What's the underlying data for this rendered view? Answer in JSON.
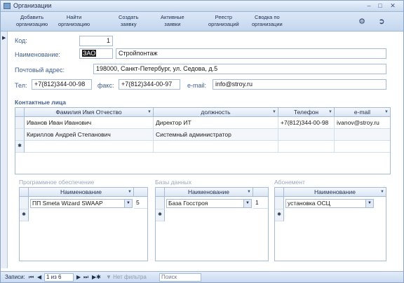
{
  "window": {
    "title": "Организации"
  },
  "toolbar": {
    "add_org": [
      "Добавить",
      "организацию"
    ],
    "find_org": [
      "Найти",
      "организацию"
    ],
    "create_req": [
      "Создать",
      "заявку"
    ],
    "active_req": [
      "Активные",
      "заявки"
    ],
    "registry": [
      "Реестр",
      "организаций"
    ],
    "summary": [
      "Сводка по",
      "организации"
    ]
  },
  "form": {
    "code_label": "Код:",
    "code_value": "1",
    "name_label": "Наименование:",
    "name_prefix": "ЗАО",
    "name_value": "Стройпонтаж",
    "address_label": "Почтовый адрес:",
    "address_value": "198000, Санкт-Петербург, ул. Седова, д.5",
    "phone_label": "Тел:",
    "phone_value": "+7(812)344-00-98",
    "fax_label": "факс:",
    "fax_value": "+7(812)344-00-97",
    "email_label": "e-mail:",
    "email_value": "info@stroy.ru"
  },
  "contacts": {
    "header": "Контактные лица",
    "columns": [
      "Фамилия Имя Отчество",
      "должность",
      "Телефон",
      "e-mail"
    ],
    "rows": [
      [
        "Иванов Иван Иванович",
        "Директор ИТ",
        "+7(812)344-00-98",
        "ivanov@stroy.ru"
      ],
      [
        "Кириллов Андрей Степанович",
        "Системный администратор",
        "",
        ""
      ]
    ]
  },
  "software": {
    "header": "Программное обеспечение",
    "column": "Наименование",
    "value": "ПП Smeta Wizard SWAAP",
    "count": "5"
  },
  "databases": {
    "header": "Базы данных",
    "column": "Наименование",
    "value": "База Госстроя",
    "count": "1"
  },
  "subscription": {
    "header": "Абонемент",
    "column": "Наименование",
    "value": "установка ОСЦ"
  },
  "status": {
    "records_label": "Записи:",
    "position": "1 из 6",
    "no_filter": "Нет фильтра",
    "search": "Поиск"
  }
}
